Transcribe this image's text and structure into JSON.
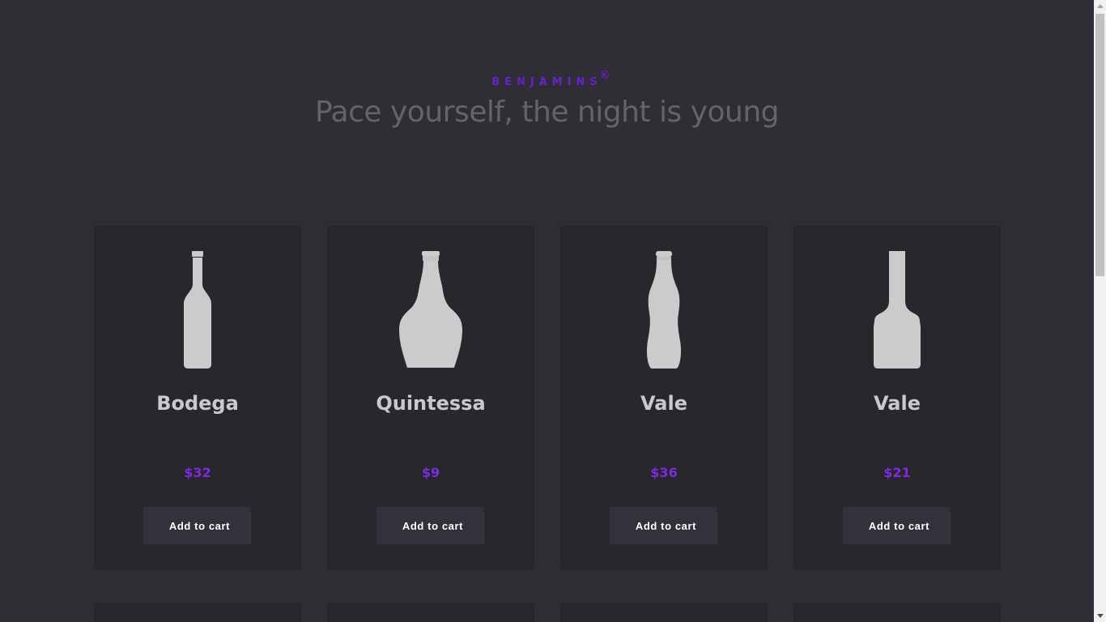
{
  "header": {
    "logo_text": "BENJAMINS",
    "logo_mark": "R",
    "tagline": "Pace yourself, the night is young"
  },
  "products": [
    {
      "name": "Bodega",
      "price": "$32",
      "button": "Add to cart",
      "icon": "wine-bottle-icon"
    },
    {
      "name": "Quintessa",
      "price": "$9",
      "button": "Add to cart",
      "icon": "decanter-bottle-icon"
    },
    {
      "name": "Vale",
      "price": "$36",
      "button": "Add to cart",
      "icon": "beer-bottle-icon"
    },
    {
      "name": "Vale",
      "price": "$21",
      "button": "Add to cart",
      "icon": "liquor-bottle-icon"
    }
  ],
  "colors": {
    "background": "#2f2e34",
    "card": "#28272c",
    "accent": "#7c2be0",
    "bottle": "#cbcbcb"
  }
}
